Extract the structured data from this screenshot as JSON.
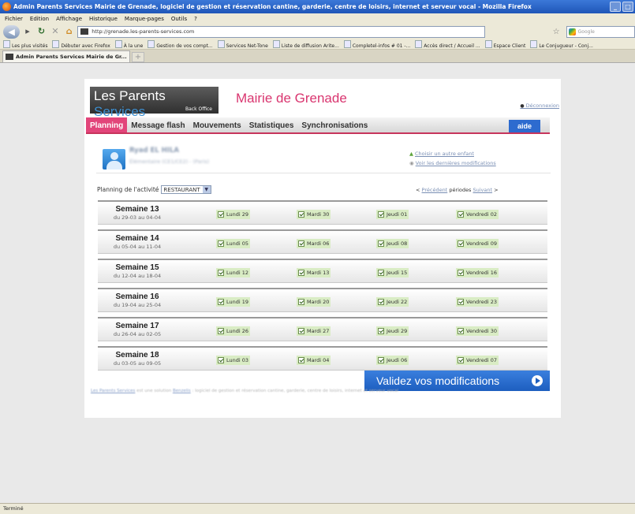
{
  "window": {
    "title": "Admin Parents Services Mairie de Grenade, logiciel de gestion et réservation cantine, garderie, centre de loisirs, internet et serveur vocal - Mozilla Firefox",
    "controls": [
      "_",
      "□"
    ]
  },
  "menu": [
    "Fichier",
    "Edition",
    "Affichage",
    "Historique",
    "Marque-pages",
    "Outils",
    "?"
  ],
  "nav": {
    "url": "http://grenade.les-parents-services.com",
    "search_placeholder": "Google"
  },
  "bookmarks": [
    "Les plus visités",
    "Débuter avec Firefox",
    "À la une",
    "Gestion de vos compt...",
    "Services Net-Tone",
    "Liste de diffusion Arite...",
    "Completel-infos # 01 -...",
    "Accès direct / Accueil ...",
    "Espace Client",
    "Le Conjugueur - Conj..."
  ],
  "tab": {
    "title": "Admin Parents Services Mairie de Gr...",
    "new": "+"
  },
  "status": "Terminé",
  "header": {
    "logo_main": "Les Parents",
    "logo_accent": "Services",
    "logo_sub": "Back Office",
    "mairie": "Mairie de Grenade",
    "logout": "Déconnexion"
  },
  "tabs": [
    "Planning",
    "Message flash",
    "Mouvements",
    "Statistiques",
    "Synchronisations"
  ],
  "help": "aide",
  "child": {
    "name": "Ryad EL HILA",
    "sub": "Élémentaire (CE1/CE2) - (Paris)",
    "link_choose": "Choisir un autre enfant",
    "link_changes": "Voir les dernières modifications"
  },
  "activity": {
    "label": "Planning de l'activité",
    "value": "RESTAURANT"
  },
  "pager": {
    "prev": "Précédent",
    "label": "périodes",
    "next": "Suivant",
    "prev_arrow": "<",
    "next_arrow": ">"
  },
  "weeks": [
    {
      "title": "Semaine 13",
      "range": "du 29-03 au 04-04",
      "days": [
        "Lundi 29",
        "Mardi 30",
        "Jeudi 01",
        "Vendredi 02"
      ]
    },
    {
      "title": "Semaine 14",
      "range": "du 05-04 au 11-04",
      "days": [
        "Lundi 05",
        "Mardi 06",
        "Jeudi 08",
        "Vendredi 09"
      ]
    },
    {
      "title": "Semaine 15",
      "range": "du 12-04 au 18-04",
      "days": [
        "Lundi 12",
        "Mardi 13",
        "Jeudi 15",
        "Vendredi 16"
      ]
    },
    {
      "title": "Semaine 16",
      "range": "du 19-04 au 25-04",
      "days": [
        "Lundi 19",
        "Mardi 20",
        "Jeudi 22",
        "Vendredi 23"
      ]
    },
    {
      "title": "Semaine 17",
      "range": "du 26-04 au 02-05",
      "days": [
        "Lundi 26",
        "Mardi 27",
        "Jeudi 29",
        "Vendredi 30"
      ]
    },
    {
      "title": "Semaine 18",
      "range": "du 03-05 au 09-05",
      "days": [
        "Lundi 03",
        "Mardi 04",
        "Jeudi 06",
        "Vendredi 07"
      ]
    }
  ],
  "validate": "Validez vos modifications",
  "footer": {
    "link1": "Les Parents Services",
    "text1": " est une solution ",
    "link2": "Benzelis",
    "text2": " : logiciel de gestion et réservation cantine, garderie, centre de loisirs, internet et serveur vocal"
  },
  "colors": {
    "accent": "#e2457a",
    "brand_blue": "#2d6bcf",
    "day_bg": "#d9ecc4"
  },
  "icons": [
    "firefox-icon",
    "back-arrow-icon",
    "forward-arrow-icon",
    "reload-icon",
    "stop-icon",
    "home-icon",
    "bookmark-star-icon",
    "user-avatar-icon",
    "checkbox-checked-icon",
    "go-arrow-icon"
  ]
}
